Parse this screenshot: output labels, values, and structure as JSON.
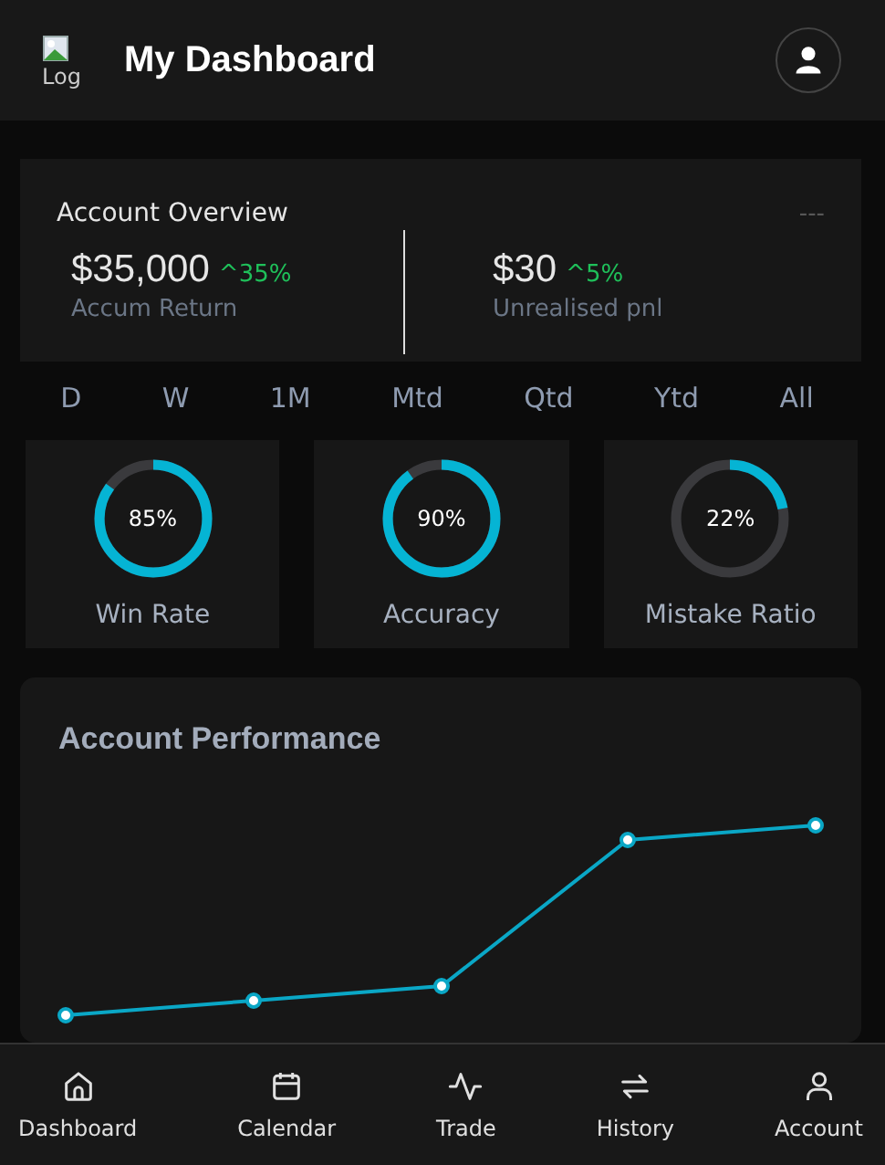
{
  "header": {
    "logo_alt": "Log",
    "title": "My Dashboard"
  },
  "overview": {
    "title": "Account Overview",
    "menu": "---",
    "metrics": [
      {
        "value": "$35,000",
        "change": "^35%",
        "label": "Accum Return"
      },
      {
        "value": "$30",
        "change": "^5%",
        "label": "Unrealised pnl"
      }
    ]
  },
  "periods": [
    {
      "label": "D",
      "selected": false
    },
    {
      "label": "W",
      "selected": false
    },
    {
      "label": "1M",
      "selected": false
    },
    {
      "label": "Mtd",
      "selected": false
    },
    {
      "label": "Qtd",
      "selected": false
    },
    {
      "label": "Ytd",
      "selected": false
    },
    {
      "label": "All",
      "selected": false
    }
  ],
  "stats": [
    {
      "reading": "85%",
      "label": "Win Rate"
    },
    {
      "reading": "90%",
      "label": "Accuracy"
    },
    {
      "reading": "22%",
      "label": "Mistake Ratio"
    }
  ],
  "performance": {
    "title": "Account Performance"
  },
  "nav": [
    {
      "label": "Dashboard",
      "kind": "home",
      "selected": false
    },
    {
      "label": "Calendar",
      "kind": "calendar",
      "selected": false
    },
    {
      "label": "Trade",
      "kind": "pulse",
      "selected": false
    },
    {
      "label": "History",
      "kind": "swap",
      "selected": false
    },
    {
      "label": "Account",
      "kind": "user",
      "selected": false
    }
  ]
}
